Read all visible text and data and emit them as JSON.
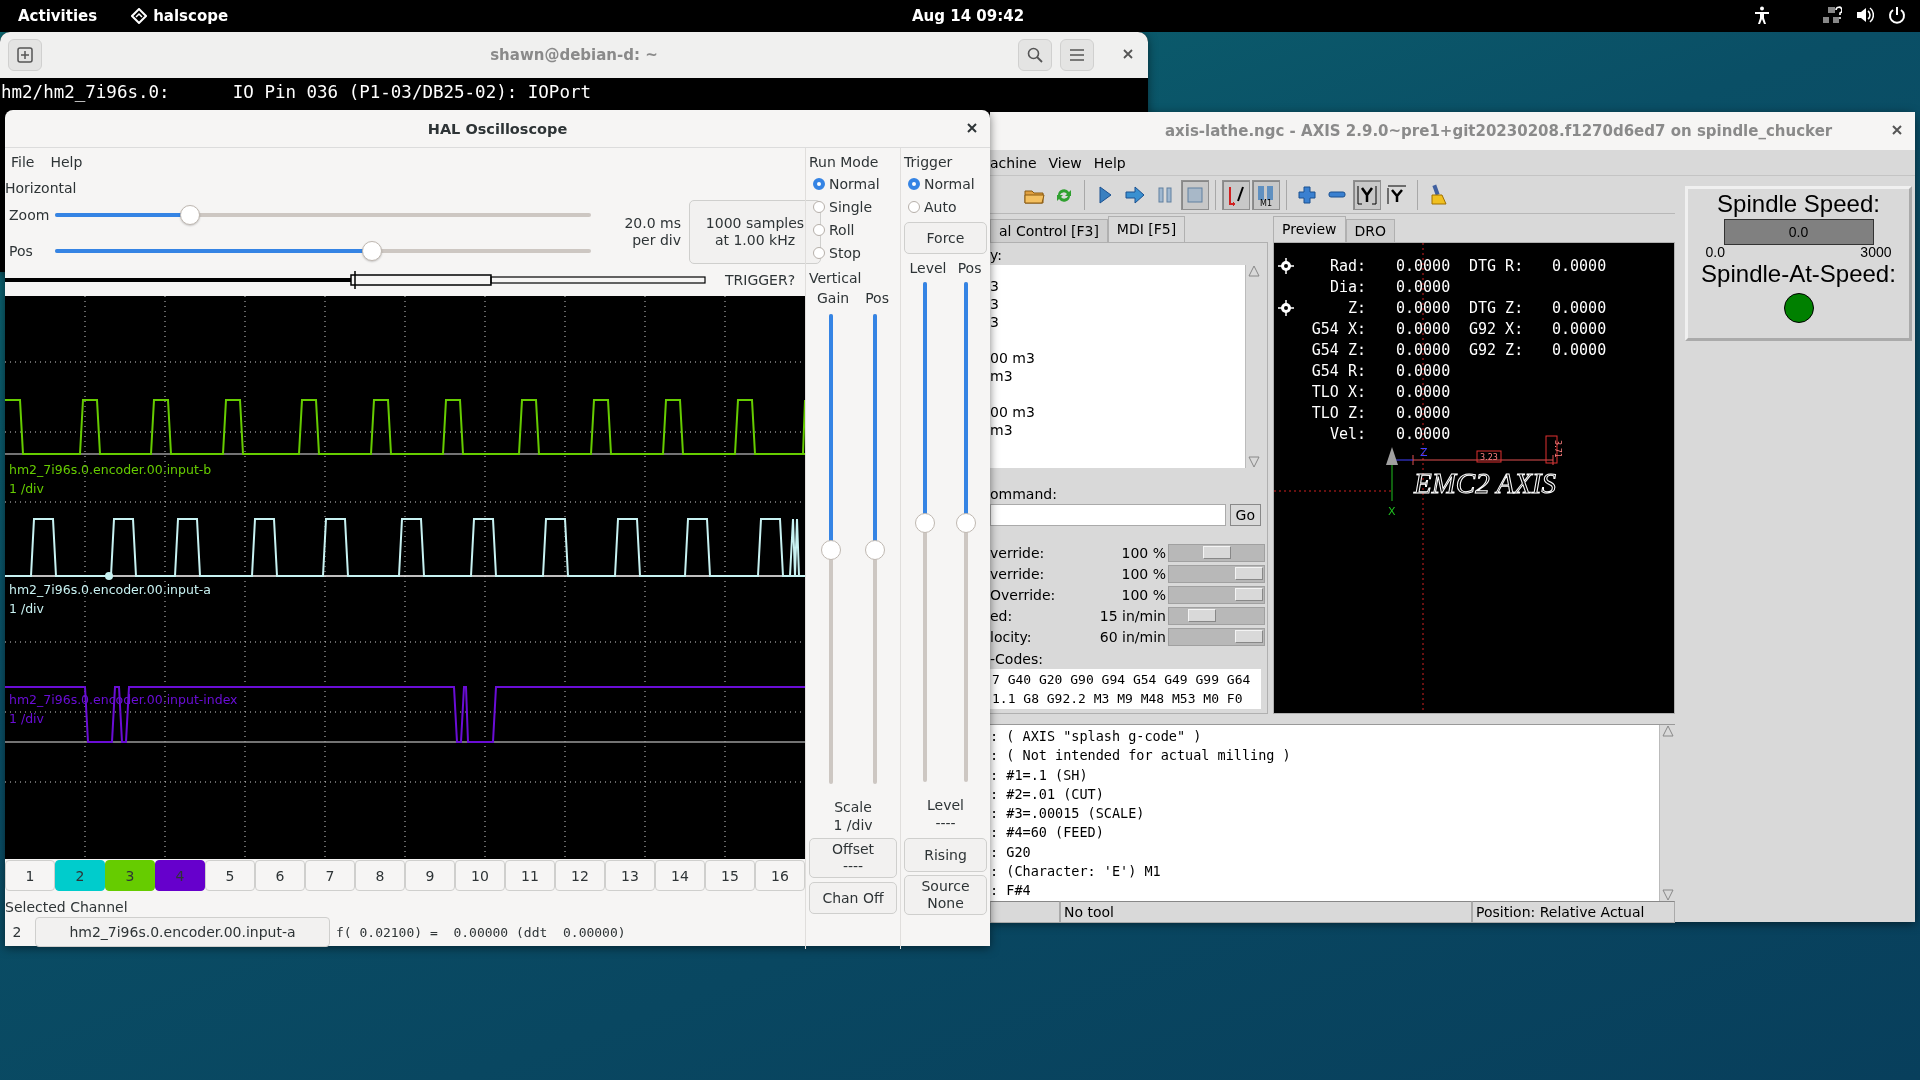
{
  "top_bar": {
    "activities": "Activities",
    "app": "halscope",
    "clock": "Aug 14  09:42"
  },
  "terminal": {
    "title": "shawn@debian-d: ~",
    "lines": [
      "hm2/hm2_7i96s.0:      IO Pin 036 (P1-03/DB25-02): IOPort"
    ]
  },
  "scope": {
    "title": "HAL Oscilloscope",
    "menu": [
      "File",
      "Help"
    ],
    "horizontal": {
      "label": "Horizontal",
      "zoom": {
        "label": "Zoom",
        "level": 0.25
      },
      "pos": {
        "label": "Pos",
        "level": 0.59
      },
      "rate": [
        "20.0 ms",
        "per div"
      ],
      "samples": [
        "1000 samples",
        "at 1.00 kHz"
      ],
      "trigger_status": "TRIGGER?"
    },
    "traces": [
      {
        "name": "hm2_7i96s.0.encoder.00.input-b",
        "scale": "1 /div",
        "color": "#66cc00"
      },
      {
        "name": "hm2_7i96s.0.encoder.00.input-a",
        "scale": "1 /div",
        "color": "#c8f2f2"
      },
      {
        "name": "hm2_7i96s.0.encoder.00.input-index",
        "scale": "1 /div",
        "color": "#6a0dd6"
      }
    ],
    "run_mode": {
      "label": "Run Mode",
      "options": [
        {
          "label": "Normal",
          "selected": true
        },
        {
          "label": "Single",
          "selected": false
        },
        {
          "label": "Roll",
          "selected": false
        },
        {
          "label": "Stop",
          "selected": false
        }
      ]
    },
    "vertical": {
      "label": "Vertical",
      "gain": {
        "label": "Gain",
        "level": 0.5
      },
      "pos": {
        "label": "Pos",
        "level": 0.5
      },
      "scale_label": "Scale",
      "scale": "1 /div",
      "offset": [
        "Offset",
        "----"
      ],
      "chan_off": "Chan Off"
    },
    "trigger": {
      "label": "Trigger",
      "options": [
        {
          "label": "Normal",
          "selected": true
        },
        {
          "label": "Auto",
          "selected": false
        }
      ],
      "force": "Force",
      "level_slider": {
        "label": "Level",
        "level": 0.52
      },
      "pos_slider": {
        "label": "Pos",
        "level": 0.52
      },
      "level_label": "Level",
      "level_value": "----",
      "edge": "Rising",
      "source": [
        "Source",
        "None"
      ]
    },
    "channels": [
      {
        "label": "1"
      },
      {
        "label": "2",
        "color": "#00cccc"
      },
      {
        "label": "3",
        "color": "#66cc00"
      },
      {
        "label": "4",
        "color": "#6600cc"
      },
      {
        "label": "5"
      },
      {
        "label": "6"
      },
      {
        "label": "7"
      },
      {
        "label": "8"
      },
      {
        "label": "9"
      },
      {
        "label": "10"
      },
      {
        "label": "11"
      },
      {
        "label": "12"
      },
      {
        "label": "13"
      },
      {
        "label": "14"
      },
      {
        "label": "15"
      },
      {
        "label": "16"
      }
    ],
    "selected_channel": {
      "label": "Selected Channel",
      "number": "2",
      "name": "hm2_7i96s.0.encoder.00.input-a",
      "value": "f( 0.02100) =  0.00000 (ddt  0.00000)"
    }
  },
  "axis": {
    "title": "axis-lathe.ngc - AXIS 2.9.0~pre1+git20230208.f1270d6ed7 on spindle_chucker",
    "menu": [
      "achine",
      "View",
      "Help"
    ],
    "toolbar": [
      {
        "items": [
          {
            "kind": "open",
            "pressed": false
          },
          {
            "kind": "reload",
            "pressed": false
          }
        ]
      },
      {
        "items": [
          {
            "kind": "run",
            "pressed": false
          },
          {
            "kind": "step",
            "pressed": false
          },
          {
            "kind": "pause",
            "pressed": false
          },
          {
            "kind": "stop",
            "pressed": true
          }
        ]
      },
      {
        "items": [
          {
            "kind": "skip",
            "pressed": true
          },
          {
            "kind": "optional_stop",
            "label": "M1",
            "pressed": true
          }
        ]
      },
      {
        "items": [
          {
            "kind": "zoom_in",
            "pressed": false
          },
          {
            "kind": "zoom_out",
            "pressed": false
          },
          {
            "kind": "view_y",
            "pressed": true
          },
          {
            "kind": "view_y_rotated",
            "pressed": false
          }
        ]
      },
      {
        "items": [
          {
            "kind": "clear",
            "pressed": false
          }
        ]
      }
    ],
    "tabs": [
      {
        "label": "al Control [F3]",
        "selected": false
      },
      {
        "label": "MDI [F5]",
        "selected": true
      }
    ],
    "mdi": {
      "history_label": "y:",
      "history": [
        "3",
        "3",
        "3",
        "00 m3",
        "m3",
        "00 m3",
        "m3"
      ],
      "command_label": "ommand:",
      "go": "Go"
    },
    "overrides": [
      {
        "label": "verride:",
        "value": "100 %",
        "level": 0.5
      },
      {
        "label": "verride:",
        "value": "100 %",
        "level": 0.98
      },
      {
        "label": "Override:",
        "value": "100 %",
        "level": 0.98
      },
      {
        "label": "ed:",
        "value": "15 in/min",
        "level": 0.28
      },
      {
        "label": "locity:",
        "value": "60 in/min",
        "level": 0.98
      }
    ],
    "gcodes_label": "-Codes:",
    "gcodes": [
      "7 G40 G20 G90 G94 G54 G49 G99 G64",
      "1.1 G8 G92.2 M3 M9 M48 M53 M0 F0"
    ],
    "view_tabs": [
      {
        "label": "Preview",
        "selected": true
      },
      {
        "label": "DRO",
        "selected": false
      }
    ],
    "dro": [
      {
        "label": "Rad:",
        "value": "0.0000",
        "label2": "DTG R:",
        "value2": "0.0000",
        "homed": true
      },
      {
        "label": "Dia:",
        "value": "0.0000",
        "homed": false
      },
      {
        "label": "Z:",
        "value": "0.0000",
        "label2": "DTG Z:",
        "value2": "0.0000",
        "homed": true
      },
      {
        "label": "G54 X:",
        "value": "0.0000",
        "label2": "G92 X:",
        "value2": "0.0000",
        "homed": false
      },
      {
        "label": "G54 Z:",
        "value": "0.0000",
        "label2": "G92 Z:",
        "value2": "0.0000",
        "homed": false
      },
      {
        "label": "G54 R:",
        "value": "0.0000",
        "homed": false
      },
      {
        "label": "TLO X:",
        "value": "0.0000",
        "homed": false
      },
      {
        "label": "TLO Z:",
        "value": "0.0000",
        "homed": false
      },
      {
        "label": "Vel:",
        "value": "0.0000",
        "homed": false
      }
    ],
    "preview": {
      "axis_z": "Z",
      "axis_x": "X",
      "dim_z": "3.23",
      "dim_end": "3.71",
      "splash": "EMC2 AXIS"
    },
    "spindle": {
      "speed_label": "Spindle Speed:",
      "speed": "0.0",
      "min": "0.0",
      "max": "3000",
      "at_speed_label": "Spindle-At-Speed:",
      "at_speed": true
    },
    "program": [
      ": ( AXIS \"splash g-code\" )",
      ": ( Not intended for actual milling )",
      ": #1=.1 (SH)",
      ": #2=.01 (CUT)",
      ": #3=.00015 (SCALE)",
      ": #4=60 (FEED)",
      ": G20",
      ": (Character: 'E') M1",
      ": F#4"
    ],
    "status": [
      "No tool",
      "Position: Relative Actual"
    ]
  }
}
